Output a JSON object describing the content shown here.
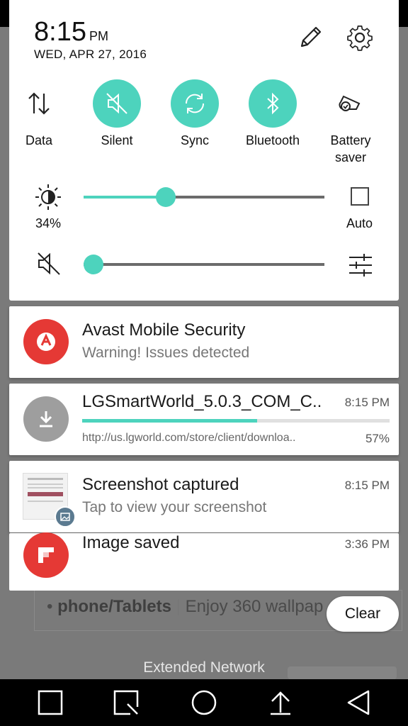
{
  "status": {
    "time": "8:15",
    "ampm": "PM",
    "date": "WED, APR 27, 2016"
  },
  "quick_settings": [
    {
      "label": "Data",
      "active": false,
      "icon": "data-arrows-icon"
    },
    {
      "label": "Silent",
      "active": true,
      "icon": "silent-icon"
    },
    {
      "label": "Sync",
      "active": true,
      "icon": "sync-icon"
    },
    {
      "label": "Bluetooth",
      "active": true,
      "icon": "bluetooth-icon"
    },
    {
      "label": "Battery saver",
      "label_line1": "Battery",
      "label_line2": "saver",
      "active": false,
      "icon": "battery-saver-icon"
    }
  ],
  "brightness": {
    "percent_label": "34%",
    "level": 0.34,
    "auto_label": "Auto"
  },
  "volume": {
    "level": 0.0
  },
  "accent_color": "#4dd3bd",
  "notifications": [
    {
      "title": "Avast Mobile Security",
      "subtitle": "Warning! Issues detected",
      "icon": "avast-icon",
      "color": "#e53935"
    },
    {
      "title": "LGSmartWorld_5.0.3_COM_C..",
      "time": "8:15 PM",
      "url": "http://us.lgworld.com/store/client/downloa..",
      "progress_label": "57%",
      "progress": 0.57,
      "icon": "download-icon",
      "color": "#9e9e9e"
    },
    {
      "title": "Screenshot captured",
      "subtitle": "Tap to view your screenshot",
      "time": "8:15 PM",
      "icon": "screenshot-thumbnail"
    },
    {
      "title": "Image saved",
      "time": "3:36 PM",
      "icon": "flipboard-icon",
      "color": "#e53935"
    }
  ],
  "clear_label": "Clear",
  "background": {
    "bullet_bold": "phone/Tablets",
    "bullet_rest": "Enjoy 360 wallpap",
    "footer": "Extended Network"
  }
}
